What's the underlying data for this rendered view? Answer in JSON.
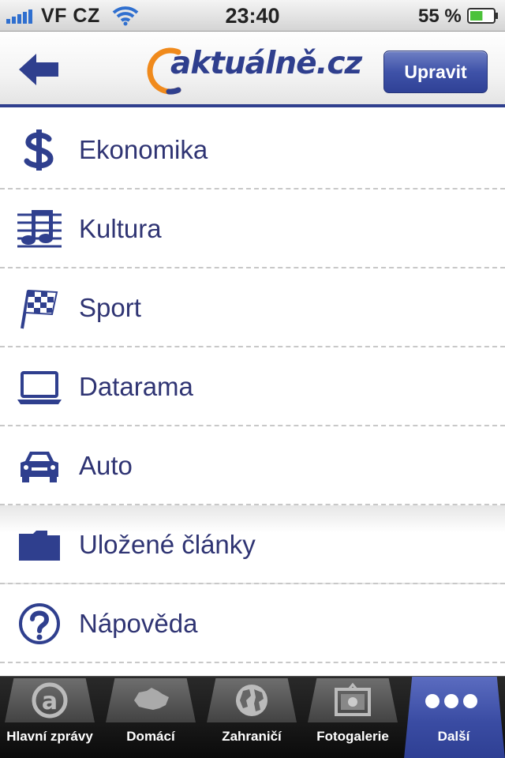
{
  "status_bar": {
    "carrier": "VF CZ",
    "time": "23:40",
    "battery_percent": "55 %",
    "battery_level": 0.55,
    "signal_icon": "signal-bars-icon",
    "wifi_icon": "wifi-icon"
  },
  "header": {
    "logo_text": "aktuálně.cz",
    "edit_label": "Upravit",
    "back_icon": "back-arrow-icon"
  },
  "menu": {
    "primary": [
      {
        "label": "Ekonomika",
        "icon": "dollar-icon"
      },
      {
        "label": "Kultura",
        "icon": "music-icon"
      },
      {
        "label": "Sport",
        "icon": "checkered-flag-icon"
      },
      {
        "label": "Datarama",
        "icon": "laptop-icon"
      },
      {
        "label": "Auto",
        "icon": "car-icon"
      }
    ],
    "secondary": [
      {
        "label": "Uložené články",
        "icon": "folder-icon"
      },
      {
        "label": "Nápověda",
        "icon": "help-icon"
      }
    ]
  },
  "tab_bar": {
    "tabs": [
      {
        "label": "Hlavní zprávy",
        "icon": "aktualne-a-icon"
      },
      {
        "label": "Domácí",
        "icon": "czech-map-icon"
      },
      {
        "label": "Zahraničí",
        "icon": "globe-icon"
      },
      {
        "label": "Fotogalerie",
        "icon": "photo-frame-icon"
      },
      {
        "label": "Další",
        "icon": "more-dots-icon"
      }
    ],
    "active_index": 4
  },
  "colors": {
    "brand_blue": "#2f3f8e",
    "brand_orange": "#f08a1c",
    "list_text": "#2f3473",
    "active_tab": "#3a4ca3"
  }
}
